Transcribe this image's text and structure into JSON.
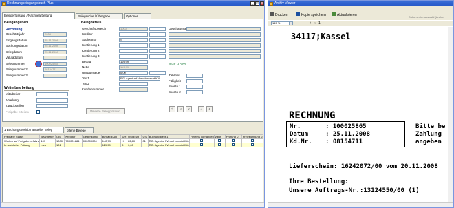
{
  "left": {
    "title": "Rechnungseingangsbuch Plus",
    "tabs": [
      "Belegerfassung / Nachbearbeitung",
      "Belegsuche / Übergabe",
      "Optionen"
    ],
    "belegangaben": {
      "header": "Belegangaben",
      "sub": "Rechnung",
      "labels": [
        "Geschäftsjahr",
        "Eingangsdatum",
        "Buchungsdatum",
        "Belegdatum",
        "Valutadatum",
        "Belegnummer",
        "Belegnummer 2",
        "Belegnummer 3"
      ],
      "values": [
        "2008",
        "25.11.2008",
        "25.11.2008",
        "25.11.2008",
        "",
        "100025865",
        "08154711",
        ""
      ]
    },
    "belegdetails": {
      "header": "Belegdetails",
      "labels": [
        "Geschäftsbereich",
        "Kreditor",
        "Sachkonto",
        "Kontierung 1",
        "Kontierung 2",
        "Kontierung 3",
        "Betrag",
        "Netto",
        "Umsatzsteuer",
        "Text1",
        "Text2",
        "Kundennummer"
      ],
      "values": [
        "1000",
        "",
        "S",
        "",
        "",
        "",
        "119,99",
        "119,99",
        "0,00",
        "RG. Agentur f.Verkehrsrecht Köln",
        "",
        ""
      ],
      "right_labels": [
        "Geschäftsstelle",
        "Zahlziel",
        "Fälligkeit",
        "Skonto 1",
        "Skonto 2"
      ],
      "rest": "Rest: H  0,00"
    },
    "weiter": {
      "header": "Weiterbearbeitung",
      "labels": [
        "Mitarbeiter",
        "Abteilung",
        "Zurückstellen",
        "Freigabe erteilen"
      ]
    },
    "btn_belege": "Weitere Belegposition",
    "bottom_tabs": [
      "1 Buchungsposition aktueller Beleg",
      "offene Belege"
    ],
    "table": {
      "headers": [
        "Freigabe Status",
        "Bearbeiter",
        "GB",
        "Kreditor",
        "Gegenkonto",
        "Betrag EUR",
        "S/H",
        "USt EUR",
        "USt",
        "Buchungstext 1",
        "Hinweis vorhanden",
        "zahlt",
        "Prüfung ©",
        "Freizeichnung ©"
      ],
      "rows": [
        [
          "Warten auf Freigabeverfahren",
          "101",
          "1000",
          "700001884",
          "000000000",
          "142,79",
          "H",
          "22,80",
          "01",
          "RG. Agentur f.Verkehrsrecht Köln",
          "",
          "",
          "",
          ""
        ],
        [
          "In sachlicher Prüfung",
          "mes",
          "101",
          "",
          "",
          "119,99",
          "S",
          "0,00",
          "",
          "RG. Agentur f.Verkehrsrecht Köln",
          "",
          "",
          "",
          ""
        ]
      ]
    }
  },
  "right": {
    "title": "Archiv Viewer",
    "toolbar": [
      "Drucken",
      "Kopie speichern",
      "Aktualisieren"
    ],
    "hint": "Dokumentenauswahl (Archiv)",
    "zoom": "145 %",
    "doc": {
      "address": "34117;Kassel",
      "heading": "RECHNUNG",
      "nr_label": "Nr.",
      "nr": ": 100025865",
      "datum_label": "Datum",
      "datum": ": 25.11.2008",
      "kd_label": "Kd.Nr.",
      "kd": ": 08154711",
      "side1": "Bitte be",
      "side2": "Zahlung",
      "side3": "angeben",
      "lieferschein": "Lieferschein: 16242072/00 vom 20.11.2008",
      "ihre": "Ihre Bestellung:",
      "auftrag": "Unsere Auftrags-Nr.:13124550/00 (1)"
    }
  }
}
